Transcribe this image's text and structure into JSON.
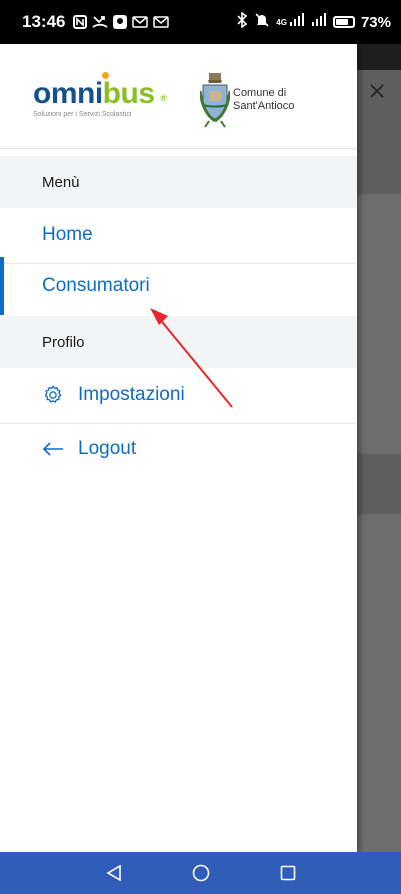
{
  "status_bar": {
    "time": "13:46",
    "network": "4G",
    "battery": "73%",
    "battery_level": 0.73
  },
  "drawer": {
    "logo": {
      "part1": "omni",
      "part2": "bus",
      "tagline": "Soluzioni per i Servizi Scolastici"
    },
    "municipality": {
      "line1": "Comune di",
      "line2": "Sant'Antioco"
    },
    "sections": {
      "menu_title": "Menù",
      "profile_title": "Profilo"
    },
    "items": {
      "home": "Home",
      "consumers": "Consumatori",
      "settings": "Impostazioni",
      "logout": "Logout"
    }
  },
  "colors": {
    "brand_blue": "#16518f",
    "brand_green": "#8cbf26",
    "link_blue": "#0f6cc4",
    "nav_bar": "#2f5db8",
    "annotation_arrow": "#e8262b"
  },
  "icons": {
    "close": "close-icon",
    "settings": "gear-icon",
    "logout": "arrow-left-icon",
    "back": "back-triangle-icon",
    "home": "home-circle-icon",
    "recents": "recents-square-icon"
  }
}
